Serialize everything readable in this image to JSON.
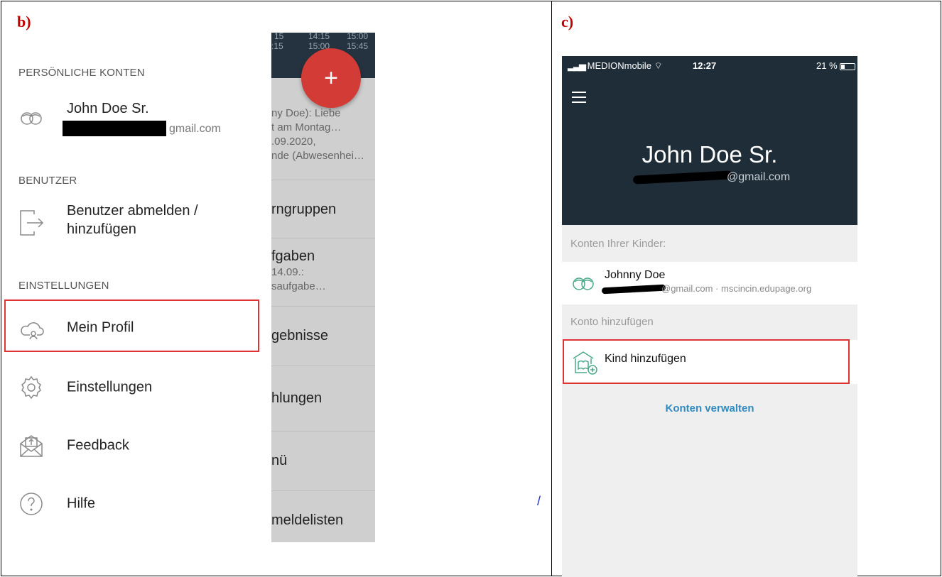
{
  "labels": {
    "b": "b)",
    "c": "c)"
  },
  "drawer": {
    "section_personal": "PERSÖNLICHE KONTEN",
    "account_name": "John Doe Sr.",
    "account_email_visible": "gmail.com",
    "section_user": "BENUTZER",
    "logout_line1": "Benutzer abmelden /",
    "logout_line2": "hinzufügen",
    "section_settings": "EINSTELLUNGEN",
    "profile": "Mein Profil",
    "settings": "Einstellungen",
    "feedback": "Feedback",
    "help": "Hilfe"
  },
  "bgapp": {
    "times_top": [
      "15",
      "14:15",
      "15:00"
    ],
    "times_bottom": [
      ":15",
      "15:00",
      "15:45"
    ],
    "fab": "+",
    "msg_lines": [
      "ny Doe): Liebe",
      "t am Montag…",
      ".09.2020,",
      "nde (Abwesenhei…"
    ],
    "row1": "rngruppen",
    "row2_title": "fgaben",
    "row2_sub1": "14.09.:",
    "row2_sub2": "saufgabe…",
    "row3": "gebnisse",
    "row4": "hlungen",
    "row5": "nü",
    "row6": "meldelisten"
  },
  "stray_mark": "/",
  "ios": {
    "carrier": "MEDIONmobile",
    "time": "12:27",
    "battery": "21 %",
    "name": "John Doe Sr.",
    "email_visible": "@gmail.com",
    "section_children": "Konten Ihrer Kinder:",
    "child_name": "Johnny Doe",
    "child_meta": "@gmail.com · mscincin.edupage.org",
    "section_add": "Konto hinzufügen",
    "add_child": "Kind hinzufügen",
    "manage": "Konten verwalten"
  },
  "colors": {
    "hero": "#1f2d38",
    "accent_red": "#d23b36",
    "link_blue": "#2f8bc0",
    "icon_teal": "#4aa88a"
  }
}
